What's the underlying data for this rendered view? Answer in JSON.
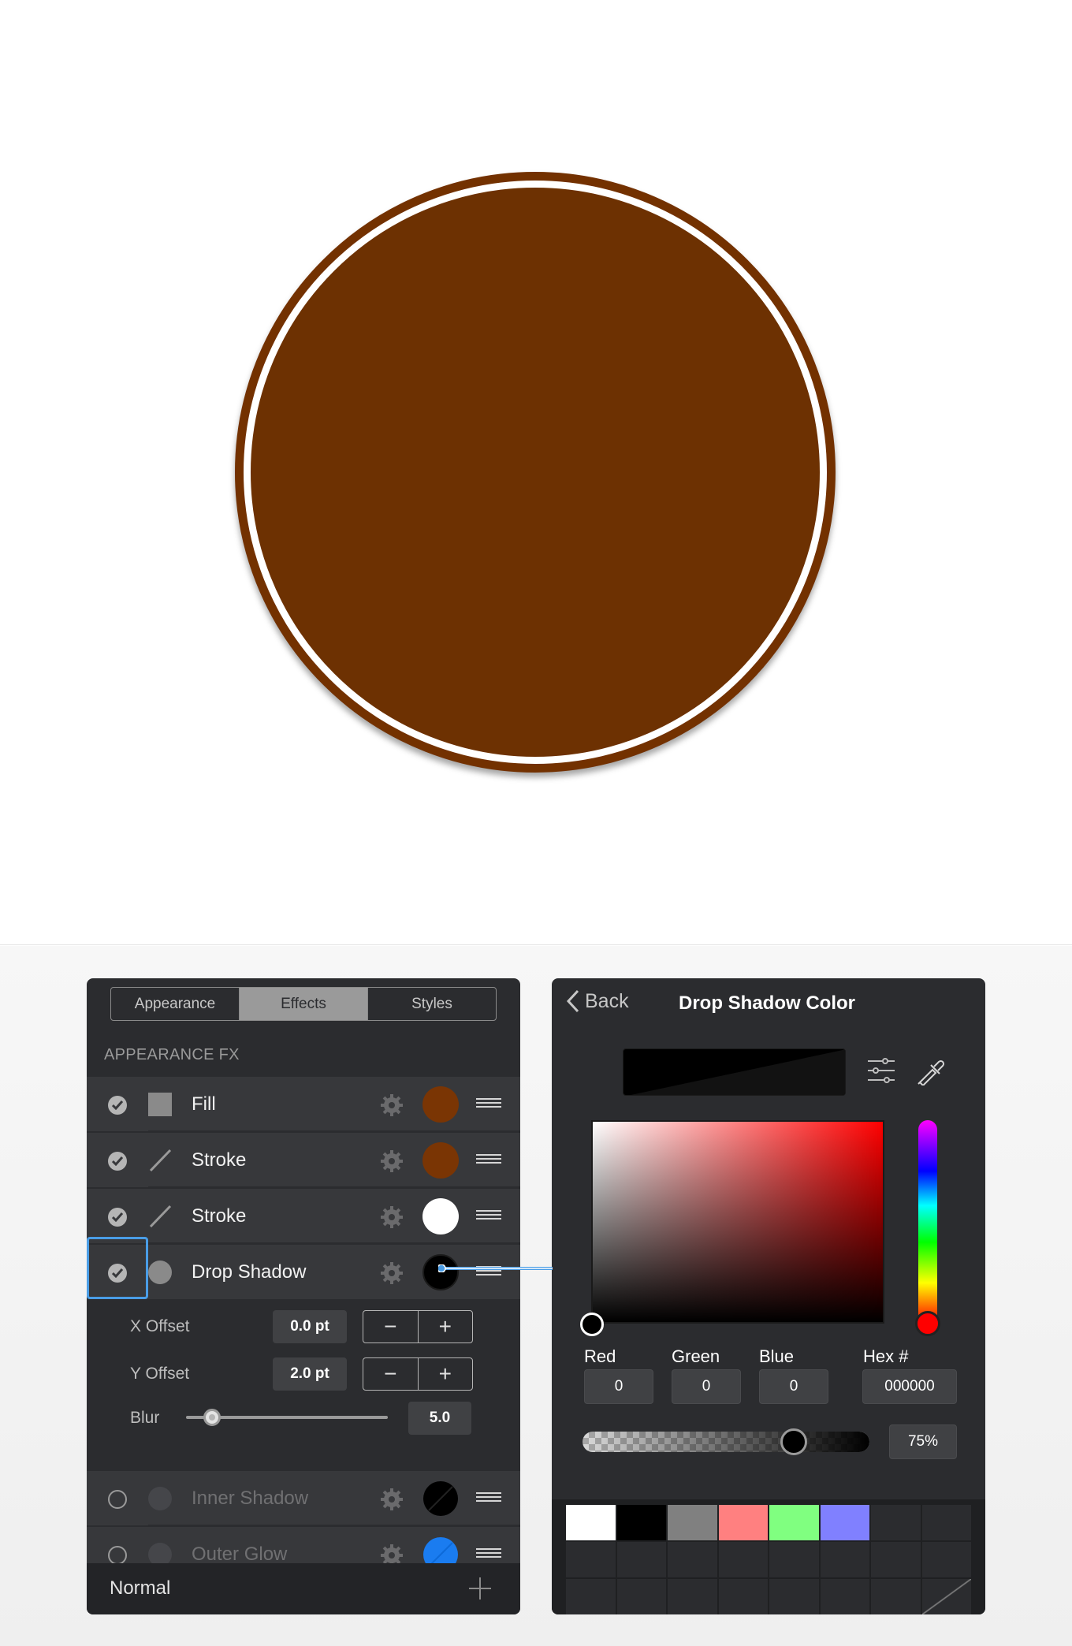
{
  "canvas": {
    "circle_fill_color": "#733100",
    "outer_stroke_color": "#733100",
    "inner_stroke_color": "#ffffff"
  },
  "appearance_panel": {
    "tabs": [
      {
        "label": "Appearance",
        "active": false
      },
      {
        "label": "Effects",
        "active": true
      },
      {
        "label": "Styles",
        "active": false
      }
    ],
    "section_label": "APPEARANCE FX",
    "rows": [
      {
        "label": "Fill",
        "enabled": true,
        "icon": "square-fill-icon",
        "swatch_color": "#7a3504"
      },
      {
        "label": "Stroke",
        "enabled": true,
        "icon": "stroke-line-icon",
        "swatch_color": "#7a3504"
      },
      {
        "label": "Stroke",
        "enabled": true,
        "icon": "stroke-line-icon",
        "swatch_color": "#ffffff"
      },
      {
        "label": "Drop Shadow",
        "enabled": true,
        "icon": "shadow-circle-icon",
        "swatch_color": "#000000"
      },
      {
        "label": "Inner Shadow",
        "enabled": false,
        "icon": "shadow-circle-icon",
        "swatch_color": "#000000"
      },
      {
        "label": "Outer Glow",
        "enabled": false,
        "icon": "shadow-circle-icon",
        "swatch_color": "#1a7cf0"
      }
    ],
    "drop_shadow_controls": {
      "x_offset_label": "X Offset",
      "x_offset_value": "0.0 pt",
      "y_offset_label": "Y Offset",
      "y_offset_value": "2.0 pt",
      "blur_label": "Blur",
      "blur_value": "5.0",
      "blur_slider_fraction": 0.14
    },
    "footer": {
      "blend_mode": "Normal"
    }
  },
  "color_panel": {
    "back_label": "Back",
    "title": "Drop Shadow Color",
    "red_label": "Red",
    "green_label": "Green",
    "blue_label": "Blue",
    "hex_label": "Hex #",
    "red_value": "0",
    "green_value": "0",
    "blue_value": "0",
    "hex_value": "000000",
    "opacity_value": "75%",
    "opacity_fraction": 0.75,
    "hue_color": "#ff0000",
    "swatches": [
      "#ffffff",
      "#000000",
      "#808080",
      "#ff8080",
      "#80ff80",
      "#8080ff",
      "",
      "",
      "",
      "",
      "",
      "",
      "",
      "",
      "",
      "",
      "",
      "",
      "",
      "",
      "",
      "",
      "",
      "none"
    ]
  }
}
